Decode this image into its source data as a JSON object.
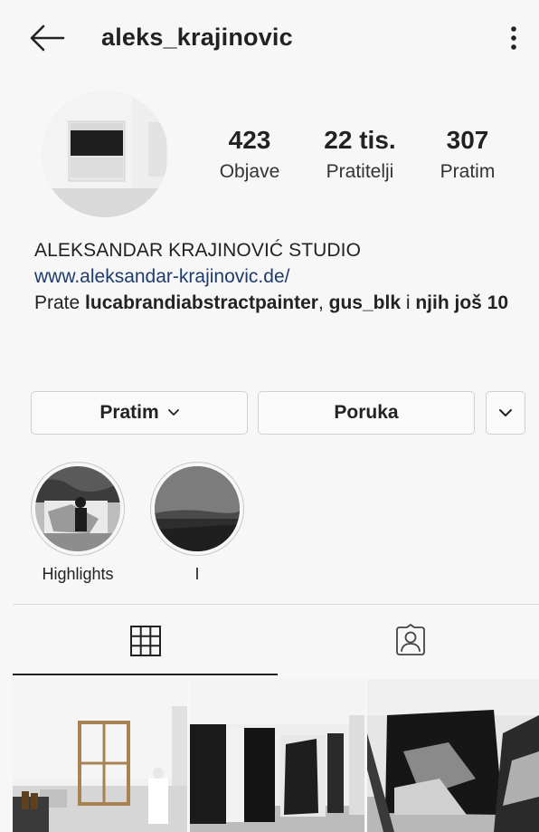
{
  "header": {
    "back_icon": "arrow-left-icon",
    "username": "aleks_krajinovic",
    "more_icon": "more-vertical-icon"
  },
  "stats": {
    "posts": {
      "value": "423",
      "label": "Objave"
    },
    "followers": {
      "value": "22 tis.",
      "label": "Pratitelji"
    },
    "following": {
      "value": "307",
      "label": "Pratim"
    }
  },
  "bio": {
    "name": "ALEKSANDAR KRAJINOVIĆ STUDIO",
    "website": "www.aleksandar-krajinovic.de/",
    "followed_prefix": "Prate",
    "followed_user1": "lucabrandiabstractpainter",
    "comma": ",",
    "followed_user2": "gus_blk",
    "conjunction": "i",
    "others": "njih još 10"
  },
  "actions": {
    "follow_label": "Pratim",
    "message_label": "Poruka"
  },
  "highlights": [
    {
      "label": "Highlights"
    },
    {
      "label": "I"
    }
  ],
  "tabs": [
    {
      "icon": "grid-icon"
    },
    {
      "icon": "tagged-person-icon"
    }
  ],
  "colors": {
    "background": "#f7f7f7",
    "link": "#1e3b6e",
    "text": "#222222",
    "border": "#d0d0d0"
  }
}
